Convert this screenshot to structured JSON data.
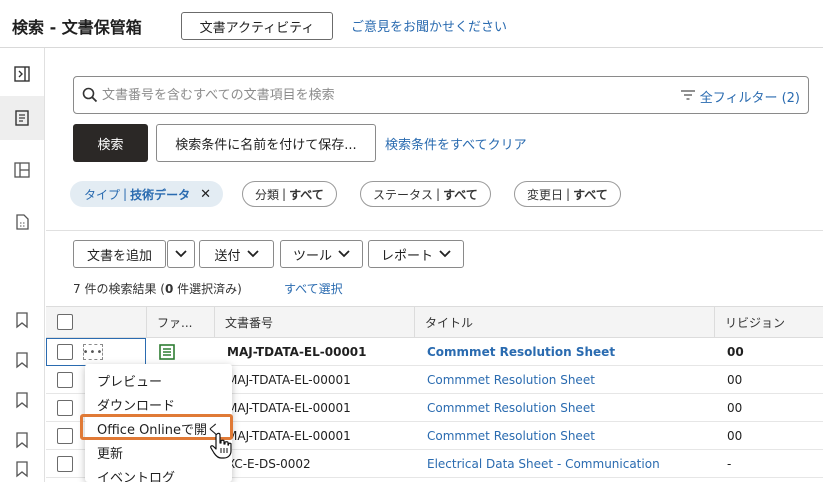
{
  "header": {
    "title": "検索 - 文書保管箱",
    "activity_button": "文書アクティビティ",
    "feedback_link": "ご意見をお聞かせください"
  },
  "search": {
    "placeholder": "文書番号を含むすべての文書項目を検索",
    "filter_all": "全フィルター (2)",
    "search_button": "検索",
    "save_button": "検索条件に名前を付けて保存...",
    "clear_link": "検索条件をすべてクリア"
  },
  "chips": {
    "type": {
      "label": "タイプ",
      "value": "技術データ"
    },
    "category": {
      "label": "分類",
      "value": "すべて"
    },
    "status": {
      "label": "ステータス",
      "value": "すべて"
    },
    "modified": {
      "label": "変更日",
      "value": "すべて"
    }
  },
  "toolbar": {
    "add_document": "文書を追加",
    "send": "送付",
    "tools": "ツール",
    "report": "レポート"
  },
  "results": {
    "prefix": "7 件の検索結果 (",
    "selected_count": "0",
    "suffix": " 件選択済み)",
    "select_all": "すべて選択"
  },
  "table": {
    "columns": [
      "ファ...",
      "文書番号",
      "タイトル",
      "リビジョン"
    ],
    "rows": [
      {
        "doc_no": "MAJ-TDATA-EL-00001",
        "title": "Commmet Resolution Sheet",
        "revision": "00"
      },
      {
        "doc_no": "MAJ-TDATA-EL-00001",
        "title": "Commmet Resolution Sheet",
        "revision": "00"
      },
      {
        "doc_no": "MAJ-TDATA-EL-00001",
        "title": "Commmet Resolution Sheet",
        "revision": "00"
      },
      {
        "doc_no": "MAJ-TDATA-EL-00001",
        "title": "Commmet Resolution Sheet",
        "revision": "00"
      },
      {
        "doc_no": "XC-E-DS-0002",
        "title": "Electrical Data Sheet - Communication",
        "revision": "-"
      }
    ]
  },
  "context_menu": {
    "items": [
      "プレビュー",
      "ダウンロード",
      "Office Onlineで開く",
      "更新",
      "イベントログ"
    ],
    "highlighted_index": 2
  },
  "colors": {
    "accent": "#2a6bb0",
    "primary_button": "#2b2826",
    "highlight": "#e07a36",
    "file_icon": "#2e7d32"
  }
}
